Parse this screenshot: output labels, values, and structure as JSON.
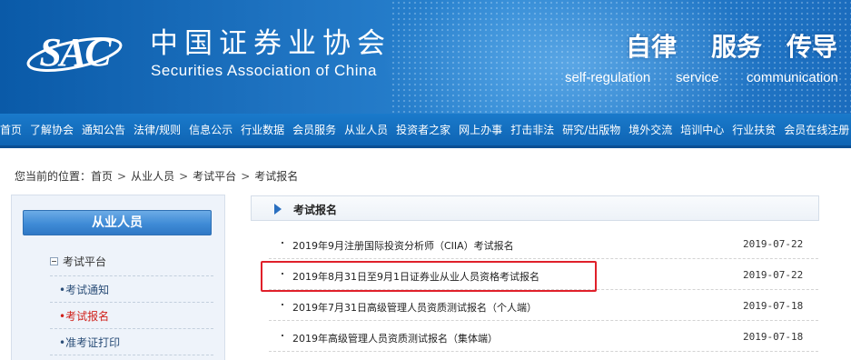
{
  "header": {
    "logo_mark": "SAC",
    "org_name_cn": "中国证券业协会",
    "org_name_en": "Securities Association of China",
    "slogans": [
      {
        "cn": "自律",
        "en": "self-regulation"
      },
      {
        "cn": "服务",
        "en": "service"
      },
      {
        "cn": "传导",
        "en": "communication"
      }
    ],
    "banner_color": "#1f74c2"
  },
  "nav": {
    "items": [
      "首页",
      "了解协会",
      "通知公告",
      "法律/规则",
      "信息公示",
      "行业数据",
      "会员服务",
      "从业人员",
      "投资者之家",
      "网上办事",
      "打击非法",
      "研究/出版物",
      "境外交流",
      "培训中心",
      "行业扶贫",
      "会员在线注册"
    ]
  },
  "breadcrumb": {
    "prefix": "您当前的位置：",
    "items": [
      "首页",
      "从业人员",
      "考试平台",
      "考试报名"
    ],
    "separator": ">"
  },
  "sidebar": {
    "title": "从业人员",
    "group": "考试平台",
    "items": [
      {
        "label": "•考试通知",
        "active": false
      },
      {
        "label": "•考试报名",
        "active": true
      },
      {
        "label": "•准考证打印",
        "active": false
      }
    ]
  },
  "content": {
    "section_title": "考试报名",
    "bullet": "·",
    "list": [
      {
        "title": "2019年9月注册国际投资分析师（CIIA）考试报名",
        "date": "2019-07-22"
      },
      {
        "title": "2019年8月31日至9月1日证券业从业人员资格考试报名",
        "date": "2019-07-22"
      },
      {
        "title": "2019年7月31日高级管理人员资质测试报名（个人端）",
        "date": "2019-07-18"
      },
      {
        "title": "2019年高级管理人员资质测试报名（集体端）",
        "date": "2019-07-18"
      }
    ],
    "highlighted_row_index": 1,
    "highlight_color": "#e0202a",
    "accent_color": "#2a6fc0",
    "active_link_color": "#d0201a"
  }
}
